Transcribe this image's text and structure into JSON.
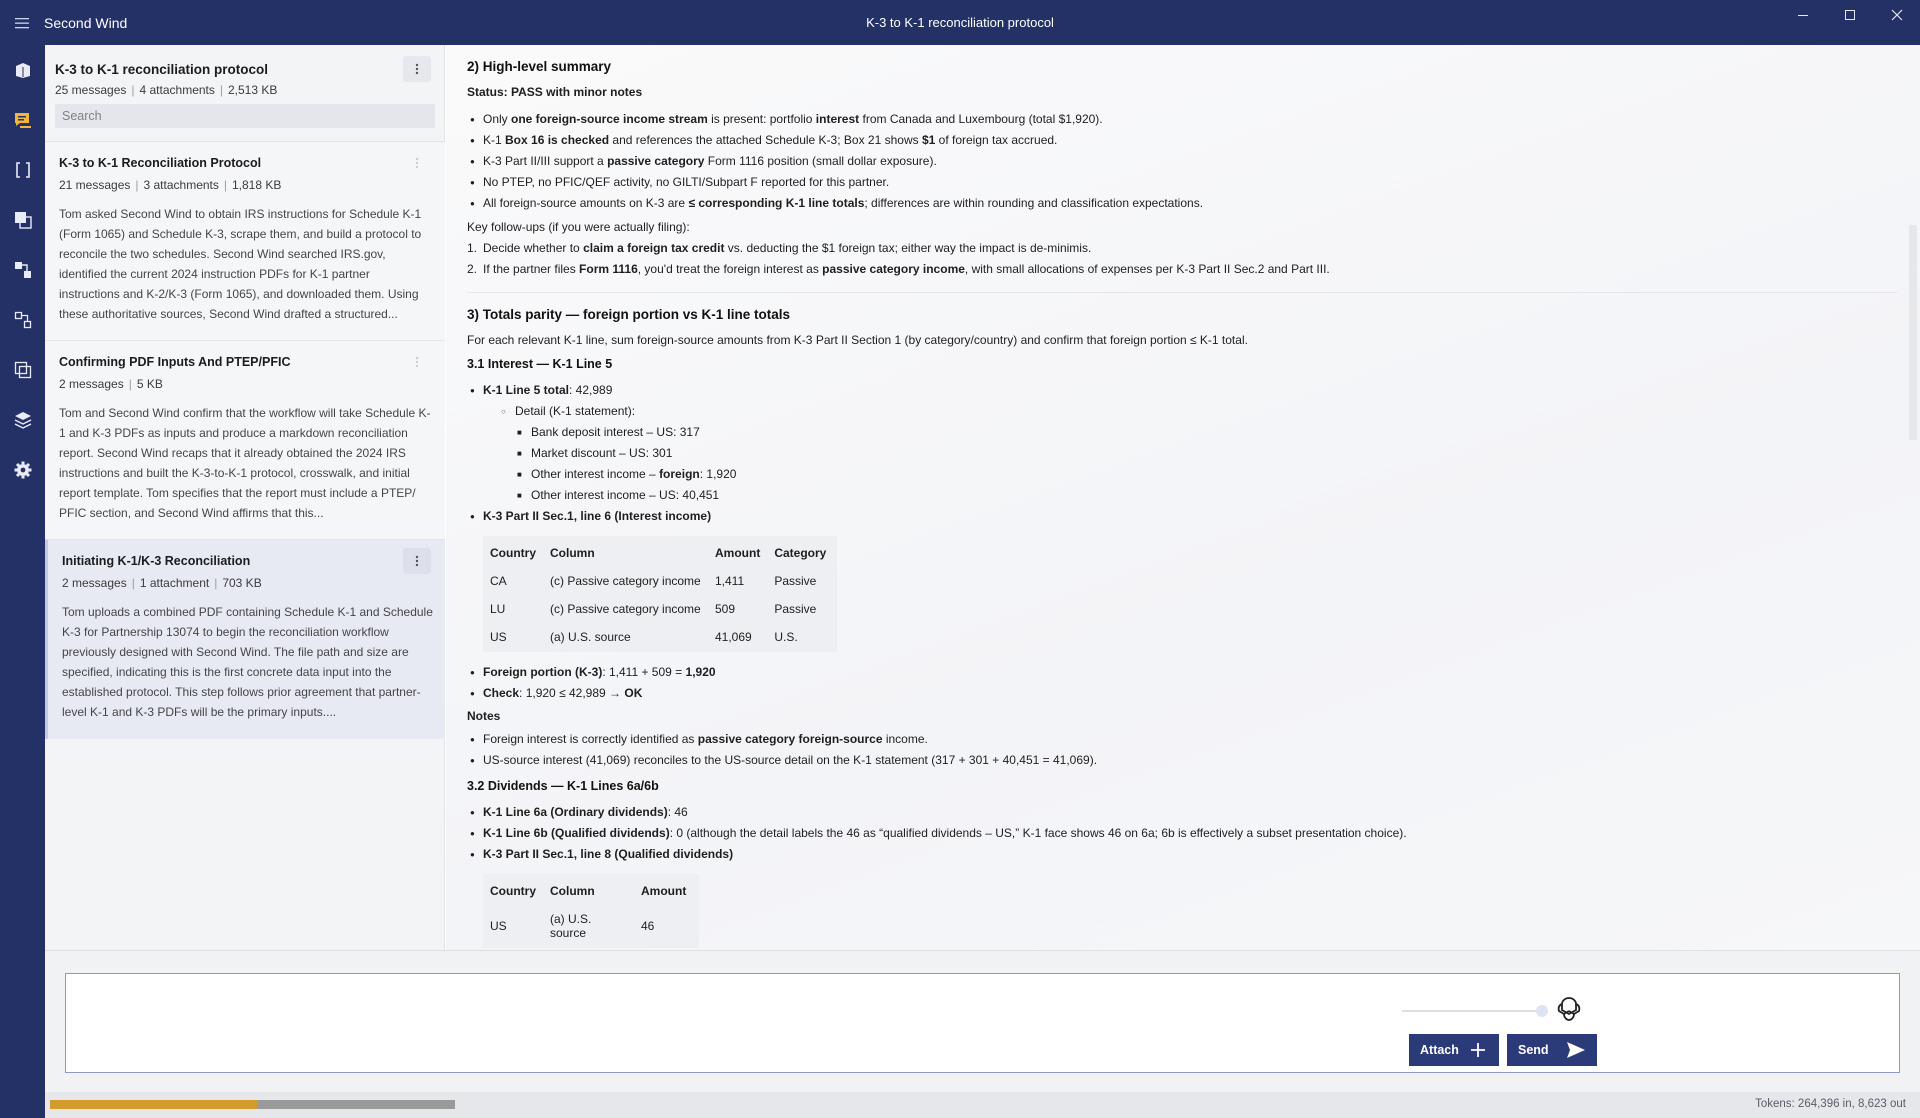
{
  "app": {
    "name": "Second Wind",
    "window_title": "K-3 to K-1 reconciliation protocol"
  },
  "rail": {
    "icons": [
      "book-icon",
      "chat-icon",
      "brackets-icon",
      "documents-icon",
      "workflow-icon",
      "diagram-icon",
      "layers-window-icon",
      "stack-icon",
      "settings-icon"
    ]
  },
  "list": {
    "title": "K-3 to K-1 reconciliation protocol",
    "messages": "25 messages",
    "attachments": "4 attachments",
    "size": "2,513 KB",
    "search_placeholder": "Search",
    "conversations": [
      {
        "title": "K-3 to K-1 Reconciliation Protocol",
        "messages": "21 messages",
        "attachments": "3 attachments",
        "size": "1,818 KB",
        "summary": "Tom asked Second Wind to obtain IRS instructions for Schedule K-1 (Form 1065) and Schedule K-3, scrape them, and build a protocol to reconcile the two schedules. Second Wind searched IRS.gov, identified the current 2024 instruction PDFs for K-1 partner instructions and K-2/K-3 (Form 1065), and downloaded them. Using these authoritative sources, Second Wind drafted a structured..."
      },
      {
        "title": "Confirming PDF Inputs And PTEP/PFIC",
        "messages": "2 messages",
        "size": "5 KB",
        "summary": "Tom and Second Wind confirm that the workflow will take Schedule K-1 and K-3 PDFs as inputs and produce a markdown reconciliation report. Second Wind recaps that it already obtained the 2024 IRS instructions and built the K-3-to-K-1 protocol, crosswalk, and initial report template. Tom specifies that the report must include a PTEP/ PFIC section, and Second Wind affirms that this..."
      },
      {
        "title": "Initiating K-1/K-3 Reconciliation",
        "messages": "2 messages",
        "attachments": "1 attachment",
        "size": "703 KB",
        "summary": "Tom uploads a combined PDF containing Schedule K-1 and Schedule K-3 for Partnership 13074 to begin the reconciliation workflow previously designed with Second Wind. The file path and size are specified, indicating this is the first concrete data input into the established protocol. This step follows prior agreement that partner-level K-1 and K-3 PDFs will be the primary inputs...."
      }
    ]
  },
  "doc": {
    "s2": {
      "heading": "2) High-level summary",
      "status": "Status: PASS with minor notes",
      "b1": {
        "a": "Only ",
        "b": "one foreign-source income stream",
        "c": " is present: portfolio ",
        "d": "interest",
        "e": " from Canada and Luxembourg (total $1,920)."
      },
      "b2": {
        "a": "K-1 ",
        "b": "Box 16 is checked",
        "c": " and references the attached Schedule K-3; Box 21 shows ",
        "d": "$1",
        "e": " of foreign tax accrued."
      },
      "b3": {
        "a": "K-3 Part II/III support a ",
        "b": "passive category",
        "c": " Form 1116 position (small dollar exposure)."
      },
      "b4": "No PTEP, no PFIC/QEF activity, no GILTI/Subpart F reported for this partner.",
      "b5": {
        "a": "All foreign-source amounts on K-3 are ",
        "b": "≤ corresponding K-1 line totals",
        "c": "; differences are within rounding and classification expectations."
      },
      "followups_label": "Key follow-ups (if you were actually filing):",
      "f1": {
        "n": "1.",
        "a": "Decide whether to ",
        "b": "claim a foreign tax credit",
        "c": " vs. deducting the $1 foreign tax; either way the impact is de-minimis."
      },
      "f2": {
        "n": "2.",
        "a": "If the partner files ",
        "b": "Form 1116",
        "c": ", you'd treat the foreign interest as ",
        "d": "passive category income",
        "e": ", with small allocations of expenses per K-3 Part II Sec.2 and Part III."
      }
    },
    "s3": {
      "heading": "3) Totals parity — foreign portion vs K-1 line totals",
      "intro": "For each relevant K-1 line, sum foreign-source amounts from K-3 Part II Section 1 (by category/country) and confirm that foreign portion ≤ K-1 total.",
      "s31": {
        "heading": "3.1 Interest — K-1 Line 5",
        "total": {
          "label": "K-1 Line 5 total",
          "value": ": 42,989"
        },
        "detail_label": "Detail (K-1 statement):",
        "detail": [
          {
            "a": "Bank deposit interest – US: 317"
          },
          {
            "a": "Market discount – US: 301"
          },
          {
            "a": "Other interest income – ",
            "b": "foreign",
            "c": ": 1,920"
          },
          {
            "a": "Other interest income – US: 40,451"
          }
        ],
        "k3_label": "K-3 Part II Sec.1, line 6 (Interest income)",
        "table": {
          "headers": [
            "Country",
            "Column",
            "Amount",
            "Category"
          ],
          "rows": [
            [
              "CA",
              "(c) Passive category income",
              "1,411",
              "Passive"
            ],
            [
              "LU",
              "(c) Passive category income",
              "509",
              "Passive"
            ],
            [
              "US",
              "(a) U.S. source",
              "41,069",
              "U.S."
            ]
          ]
        },
        "foreign": {
          "label": "Foreign portion (K-3)",
          "a": ": 1,411 + 509 = ",
          "b": "1,920"
        },
        "check": {
          "label": "Check",
          "a": ": 1,920 ≤ 42,989 → ",
          "b": "OK"
        },
        "notes_label": "Notes",
        "n1": {
          "a": "Foreign interest is correctly identified as ",
          "b": "passive category foreign-source",
          "c": " income."
        },
        "n2": "US-source interest (41,069) reconciles to the US-source detail on the K-1 statement (317 + 301 + 40,451 = 41,069)."
      },
      "s32": {
        "heading": "3.2 Dividends — K-1 Lines 6a/6b",
        "b1": {
          "label": "K-1 Line 6a (Ordinary dividends)",
          "a": ": 46"
        },
        "b2": {
          "label": "K-1 Line 6b (Qualified dividends)",
          "a": ": 0 (although the detail labels the 46 as “qualified dividends – US,” K-1 face shows 46 on 6a; 6b is effectively a subset presentation choice)."
        },
        "b3": "K-3 Part II Sec.1, line 8 (Qualified dividends)",
        "table": {
          "headers": [
            "Country",
            "Column",
            "Amount"
          ],
          "rows": [
            [
              "US",
              "(a) U.S. source",
              "46"
            ]
          ]
        }
      }
    }
  },
  "composer": {
    "placeholder": "",
    "attach_label": "Attach",
    "send_label": "Send"
  },
  "status": {
    "tokens": "Tokens: 264,396 in, 8,623 out",
    "progress_fraction": 0.51
  },
  "colors": {
    "chrome": "#233166",
    "button": "#2b3a78",
    "progress_fill": "#d29b2e",
    "progress_track": "#9a9a9a"
  }
}
